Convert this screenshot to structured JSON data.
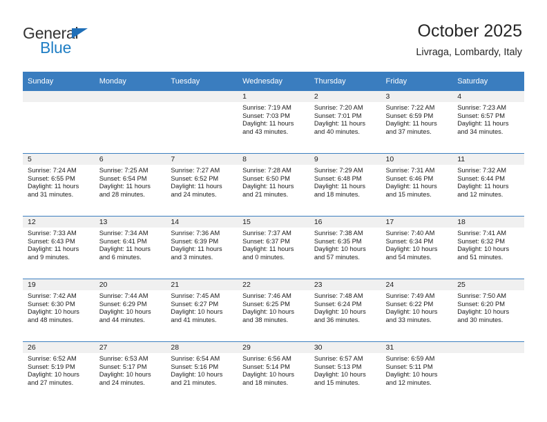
{
  "brand": {
    "name_part1": "General",
    "name_part2": "Blue",
    "triangle_icon": "blue-triangle-logo-mark",
    "color_dark": "#333333",
    "color_blue": "#1f7ec4"
  },
  "header": {
    "title": "October 2025",
    "subtitle": "Livraga, Lombardy, Italy"
  },
  "calendar": {
    "header_bg": "#3a7dbf",
    "daynum_bg": "#f0f0f0",
    "weekday_headers": [
      "Sunday",
      "Monday",
      "Tuesday",
      "Wednesday",
      "Thursday",
      "Friday",
      "Saturday"
    ],
    "weeks": [
      [
        {
          "day": "",
          "sunrise": "",
          "sunset": "",
          "daylight_line1": "",
          "daylight_line2": ""
        },
        {
          "day": "",
          "sunrise": "",
          "sunset": "",
          "daylight_line1": "",
          "daylight_line2": ""
        },
        {
          "day": "",
          "sunrise": "",
          "sunset": "",
          "daylight_line1": "",
          "daylight_line2": ""
        },
        {
          "day": "1",
          "sunrise": "Sunrise: 7:19 AM",
          "sunset": "Sunset: 7:03 PM",
          "daylight_line1": "Daylight: 11 hours",
          "daylight_line2": "and 43 minutes."
        },
        {
          "day": "2",
          "sunrise": "Sunrise: 7:20 AM",
          "sunset": "Sunset: 7:01 PM",
          "daylight_line1": "Daylight: 11 hours",
          "daylight_line2": "and 40 minutes."
        },
        {
          "day": "3",
          "sunrise": "Sunrise: 7:22 AM",
          "sunset": "Sunset: 6:59 PM",
          "daylight_line1": "Daylight: 11 hours",
          "daylight_line2": "and 37 minutes."
        },
        {
          "day": "4",
          "sunrise": "Sunrise: 7:23 AM",
          "sunset": "Sunset: 6:57 PM",
          "daylight_line1": "Daylight: 11 hours",
          "daylight_line2": "and 34 minutes."
        }
      ],
      [
        {
          "day": "5",
          "sunrise": "Sunrise: 7:24 AM",
          "sunset": "Sunset: 6:55 PM",
          "daylight_line1": "Daylight: 11 hours",
          "daylight_line2": "and 31 minutes."
        },
        {
          "day": "6",
          "sunrise": "Sunrise: 7:25 AM",
          "sunset": "Sunset: 6:54 PM",
          "daylight_line1": "Daylight: 11 hours",
          "daylight_line2": "and 28 minutes."
        },
        {
          "day": "7",
          "sunrise": "Sunrise: 7:27 AM",
          "sunset": "Sunset: 6:52 PM",
          "daylight_line1": "Daylight: 11 hours",
          "daylight_line2": "and 24 minutes."
        },
        {
          "day": "8",
          "sunrise": "Sunrise: 7:28 AM",
          "sunset": "Sunset: 6:50 PM",
          "daylight_line1": "Daylight: 11 hours",
          "daylight_line2": "and 21 minutes."
        },
        {
          "day": "9",
          "sunrise": "Sunrise: 7:29 AM",
          "sunset": "Sunset: 6:48 PM",
          "daylight_line1": "Daylight: 11 hours",
          "daylight_line2": "and 18 minutes."
        },
        {
          "day": "10",
          "sunrise": "Sunrise: 7:31 AM",
          "sunset": "Sunset: 6:46 PM",
          "daylight_line1": "Daylight: 11 hours",
          "daylight_line2": "and 15 minutes."
        },
        {
          "day": "11",
          "sunrise": "Sunrise: 7:32 AM",
          "sunset": "Sunset: 6:44 PM",
          "daylight_line1": "Daylight: 11 hours",
          "daylight_line2": "and 12 minutes."
        }
      ],
      [
        {
          "day": "12",
          "sunrise": "Sunrise: 7:33 AM",
          "sunset": "Sunset: 6:43 PM",
          "daylight_line1": "Daylight: 11 hours",
          "daylight_line2": "and 9 minutes."
        },
        {
          "day": "13",
          "sunrise": "Sunrise: 7:34 AM",
          "sunset": "Sunset: 6:41 PM",
          "daylight_line1": "Daylight: 11 hours",
          "daylight_line2": "and 6 minutes."
        },
        {
          "day": "14",
          "sunrise": "Sunrise: 7:36 AM",
          "sunset": "Sunset: 6:39 PM",
          "daylight_line1": "Daylight: 11 hours",
          "daylight_line2": "and 3 minutes."
        },
        {
          "day": "15",
          "sunrise": "Sunrise: 7:37 AM",
          "sunset": "Sunset: 6:37 PM",
          "daylight_line1": "Daylight: 11 hours",
          "daylight_line2": "and 0 minutes."
        },
        {
          "day": "16",
          "sunrise": "Sunrise: 7:38 AM",
          "sunset": "Sunset: 6:35 PM",
          "daylight_line1": "Daylight: 10 hours",
          "daylight_line2": "and 57 minutes."
        },
        {
          "day": "17",
          "sunrise": "Sunrise: 7:40 AM",
          "sunset": "Sunset: 6:34 PM",
          "daylight_line1": "Daylight: 10 hours",
          "daylight_line2": "and 54 minutes."
        },
        {
          "day": "18",
          "sunrise": "Sunrise: 7:41 AM",
          "sunset": "Sunset: 6:32 PM",
          "daylight_line1": "Daylight: 10 hours",
          "daylight_line2": "and 51 minutes."
        }
      ],
      [
        {
          "day": "19",
          "sunrise": "Sunrise: 7:42 AM",
          "sunset": "Sunset: 6:30 PM",
          "daylight_line1": "Daylight: 10 hours",
          "daylight_line2": "and 48 minutes."
        },
        {
          "day": "20",
          "sunrise": "Sunrise: 7:44 AM",
          "sunset": "Sunset: 6:29 PM",
          "daylight_line1": "Daylight: 10 hours",
          "daylight_line2": "and 44 minutes."
        },
        {
          "day": "21",
          "sunrise": "Sunrise: 7:45 AM",
          "sunset": "Sunset: 6:27 PM",
          "daylight_line1": "Daylight: 10 hours",
          "daylight_line2": "and 41 minutes."
        },
        {
          "day": "22",
          "sunrise": "Sunrise: 7:46 AM",
          "sunset": "Sunset: 6:25 PM",
          "daylight_line1": "Daylight: 10 hours",
          "daylight_line2": "and 38 minutes."
        },
        {
          "day": "23",
          "sunrise": "Sunrise: 7:48 AM",
          "sunset": "Sunset: 6:24 PM",
          "daylight_line1": "Daylight: 10 hours",
          "daylight_line2": "and 36 minutes."
        },
        {
          "day": "24",
          "sunrise": "Sunrise: 7:49 AM",
          "sunset": "Sunset: 6:22 PM",
          "daylight_line1": "Daylight: 10 hours",
          "daylight_line2": "and 33 minutes."
        },
        {
          "day": "25",
          "sunrise": "Sunrise: 7:50 AM",
          "sunset": "Sunset: 6:20 PM",
          "daylight_line1": "Daylight: 10 hours",
          "daylight_line2": "and 30 minutes."
        }
      ],
      [
        {
          "day": "26",
          "sunrise": "Sunrise: 6:52 AM",
          "sunset": "Sunset: 5:19 PM",
          "daylight_line1": "Daylight: 10 hours",
          "daylight_line2": "and 27 minutes."
        },
        {
          "day": "27",
          "sunrise": "Sunrise: 6:53 AM",
          "sunset": "Sunset: 5:17 PM",
          "daylight_line1": "Daylight: 10 hours",
          "daylight_line2": "and 24 minutes."
        },
        {
          "day": "28",
          "sunrise": "Sunrise: 6:54 AM",
          "sunset": "Sunset: 5:16 PM",
          "daylight_line1": "Daylight: 10 hours",
          "daylight_line2": "and 21 minutes."
        },
        {
          "day": "29",
          "sunrise": "Sunrise: 6:56 AM",
          "sunset": "Sunset: 5:14 PM",
          "daylight_line1": "Daylight: 10 hours",
          "daylight_line2": "and 18 minutes."
        },
        {
          "day": "30",
          "sunrise": "Sunrise: 6:57 AM",
          "sunset": "Sunset: 5:13 PM",
          "daylight_line1": "Daylight: 10 hours",
          "daylight_line2": "and 15 minutes."
        },
        {
          "day": "31",
          "sunrise": "Sunrise: 6:59 AM",
          "sunset": "Sunset: 5:11 PM",
          "daylight_line1": "Daylight: 10 hours",
          "daylight_line2": "and 12 minutes."
        },
        {
          "day": "",
          "sunrise": "",
          "sunset": "",
          "daylight_line1": "",
          "daylight_line2": ""
        }
      ]
    ]
  }
}
